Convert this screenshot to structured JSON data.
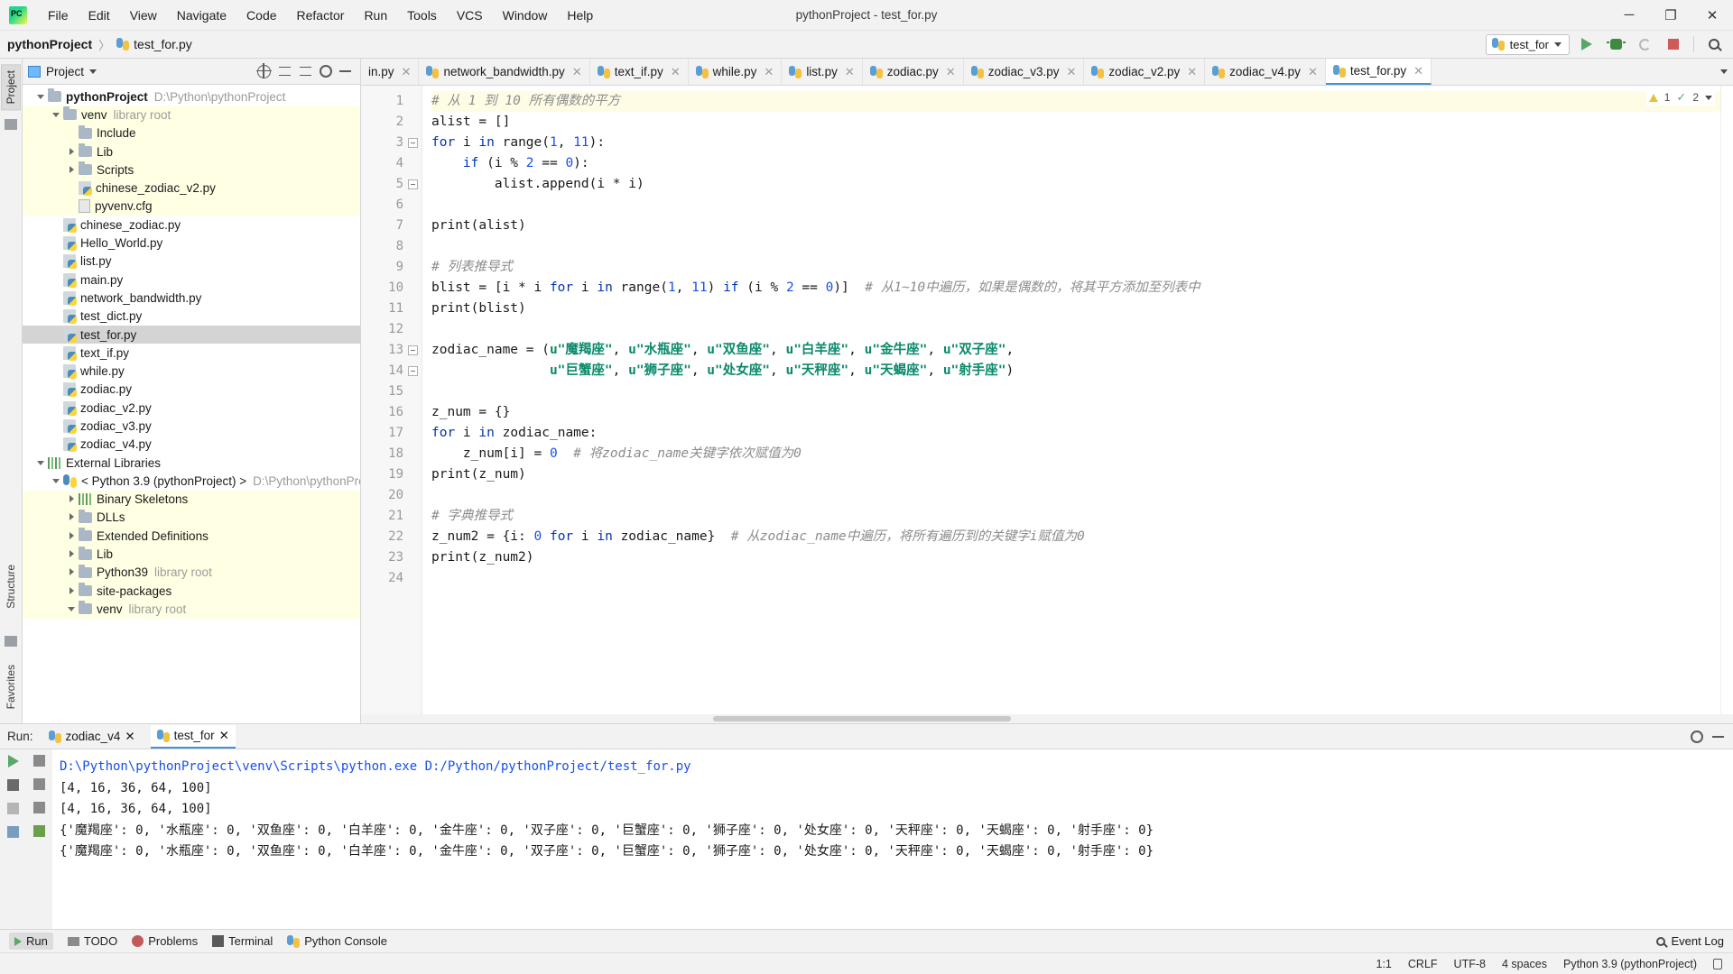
{
  "window": {
    "title": "pythonProject - test_for.py",
    "logo": "pycharm-logo",
    "minimize": "─",
    "maximize": "❐",
    "close": "✕"
  },
  "menu": [
    "File",
    "Edit",
    "View",
    "Navigate",
    "Code",
    "Refactor",
    "Run",
    "Tools",
    "VCS",
    "Window",
    "Help"
  ],
  "breadcrumb": {
    "project": "pythonProject",
    "separator": "〉",
    "file": "test_for.py"
  },
  "toolbar": {
    "run_config": "test_for",
    "run_button": "run-button",
    "debug_button": "debug-button",
    "rerun_button": "rerun-coverage-button",
    "stop_button": "stop-button",
    "search_button": "search-everywhere-button"
  },
  "project_panel": {
    "title": "Project",
    "vertical_tab": "Project",
    "tree": [
      {
        "indent": 0,
        "arrow": "down",
        "icon": "folder",
        "label": "pythonProject",
        "bold": true,
        "detail": "D:\\Python\\pythonProject",
        "highlight": "none"
      },
      {
        "indent": 1,
        "arrow": "down",
        "icon": "folder",
        "label": "venv",
        "bold": false,
        "detail": "library root",
        "highlight": "lib"
      },
      {
        "indent": 2,
        "arrow": "none",
        "icon": "folder",
        "label": "Include",
        "bold": false,
        "detail": "",
        "highlight": "lib"
      },
      {
        "indent": 2,
        "arrow": "right",
        "icon": "folder",
        "label": "Lib",
        "bold": false,
        "detail": "",
        "highlight": "lib"
      },
      {
        "indent": 2,
        "arrow": "right",
        "icon": "folder",
        "label": "Scripts",
        "bold": false,
        "detail": "",
        "highlight": "lib"
      },
      {
        "indent": 2,
        "arrow": "none",
        "icon": "python",
        "label": "chinese_zodiac_v2.py",
        "bold": false,
        "detail": "",
        "highlight": "lib"
      },
      {
        "indent": 2,
        "arrow": "none",
        "icon": "cfg",
        "label": "pyvenv.cfg",
        "bold": false,
        "detail": "",
        "highlight": "lib"
      },
      {
        "indent": 1,
        "arrow": "none",
        "icon": "python",
        "label": "chinese_zodiac.py",
        "bold": false,
        "detail": "",
        "highlight": "none"
      },
      {
        "indent": 1,
        "arrow": "none",
        "icon": "python",
        "label": "Hello_World.py",
        "bold": false,
        "detail": "",
        "highlight": "none"
      },
      {
        "indent": 1,
        "arrow": "none",
        "icon": "python",
        "label": "list.py",
        "bold": false,
        "detail": "",
        "highlight": "none"
      },
      {
        "indent": 1,
        "arrow": "none",
        "icon": "python",
        "label": "main.py",
        "bold": false,
        "detail": "",
        "highlight": "none"
      },
      {
        "indent": 1,
        "arrow": "none",
        "icon": "python",
        "label": "network_bandwidth.py",
        "bold": false,
        "detail": "",
        "highlight": "none"
      },
      {
        "indent": 1,
        "arrow": "none",
        "icon": "python",
        "label": "test_dict.py",
        "bold": false,
        "detail": "",
        "highlight": "none"
      },
      {
        "indent": 1,
        "arrow": "none",
        "icon": "python",
        "label": "test_for.py",
        "bold": false,
        "detail": "",
        "highlight": "selected"
      },
      {
        "indent": 1,
        "arrow": "none",
        "icon": "python",
        "label": "text_if.py",
        "bold": false,
        "detail": "",
        "highlight": "none"
      },
      {
        "indent": 1,
        "arrow": "none",
        "icon": "python",
        "label": "while.py",
        "bold": false,
        "detail": "",
        "highlight": "none"
      },
      {
        "indent": 1,
        "arrow": "none",
        "icon": "python",
        "label": "zodiac.py",
        "bold": false,
        "detail": "",
        "highlight": "none"
      },
      {
        "indent": 1,
        "arrow": "none",
        "icon": "python",
        "label": "zodiac_v2.py",
        "bold": false,
        "detail": "",
        "highlight": "none"
      },
      {
        "indent": 1,
        "arrow": "none",
        "icon": "python",
        "label": "zodiac_v3.py",
        "bold": false,
        "detail": "",
        "highlight": "none"
      },
      {
        "indent": 1,
        "arrow": "none",
        "icon": "python",
        "label": "zodiac_v4.py",
        "bold": false,
        "detail": "",
        "highlight": "none"
      },
      {
        "indent": 0,
        "arrow": "down",
        "icon": "library",
        "label": "External Libraries",
        "bold": false,
        "detail": "",
        "highlight": "none"
      },
      {
        "indent": 1,
        "arrow": "down",
        "icon": "pysnake",
        "label": "< Python 3.9 (pythonProject) >",
        "bold": false,
        "detail": "D:\\Python\\pythonPro",
        "highlight": "none"
      },
      {
        "indent": 2,
        "arrow": "right",
        "icon": "library",
        "label": "Binary Skeletons",
        "bold": false,
        "detail": "",
        "highlight": "lib"
      },
      {
        "indent": 2,
        "arrow": "right",
        "icon": "folder",
        "label": "DLLs",
        "bold": false,
        "detail": "",
        "highlight": "lib"
      },
      {
        "indent": 2,
        "arrow": "right",
        "icon": "folder",
        "label": "Extended Definitions",
        "bold": false,
        "detail": "",
        "highlight": "lib"
      },
      {
        "indent": 2,
        "arrow": "right",
        "icon": "folder",
        "label": "Lib",
        "bold": false,
        "detail": "",
        "highlight": "lib"
      },
      {
        "indent": 2,
        "arrow": "right",
        "icon": "folder",
        "label": "Python39",
        "bold": false,
        "detail": "library root",
        "highlight": "lib"
      },
      {
        "indent": 2,
        "arrow": "right",
        "icon": "folder",
        "label": "site-packages",
        "bold": false,
        "detail": "",
        "highlight": "lib"
      },
      {
        "indent": 2,
        "arrow": "down",
        "icon": "folder",
        "label": "venv",
        "bold": false,
        "detail": "library root",
        "highlight": "lib"
      }
    ]
  },
  "editor": {
    "tabs": [
      {
        "label": "in.py",
        "active": false
      },
      {
        "label": "network_bandwidth.py",
        "active": false
      },
      {
        "label": "text_if.py",
        "active": false
      },
      {
        "label": "while.py",
        "active": false
      },
      {
        "label": "list.py",
        "active": false
      },
      {
        "label": "zodiac.py",
        "active": false
      },
      {
        "label": "zodiac_v3.py",
        "active": false
      },
      {
        "label": "zodiac_v2.py",
        "active": false
      },
      {
        "label": "zodiac_v4.py",
        "active": false
      },
      {
        "label": "test_for.py",
        "active": true
      }
    ],
    "inspection": {
      "warnings": "1",
      "checks": "2"
    },
    "line_numbers": [
      "1",
      "2",
      "3",
      "4",
      "5",
      "6",
      "7",
      "8",
      "9",
      "10",
      "11",
      "12",
      "13",
      "14",
      "15",
      "16",
      "17",
      "18",
      "19",
      "20",
      "21",
      "22",
      "23",
      "24"
    ],
    "lines": [
      "# 从 1 到 10 所有偶数的平方",
      "alist = []",
      "for i in range(1, 11):",
      "    if (i % 2 == 0):",
      "        alist.append(i * i)",
      "",
      "print(alist)",
      "",
      "# 列表推导式",
      "blist = [i * i for i in range(1, 11) if (i % 2 == 0)]  # 从1~10中遍历，如果是偶数的，将其平方添加至列表中",
      "print(blist)",
      "",
      "zodiac_name = (u\"魔羯座\", u\"水瓶座\", u\"双鱼座\", u\"白羊座\", u\"金牛座\", u\"双子座\",",
      "               u\"巨蟹座\", u\"狮子座\", u\"处女座\", u\"天秤座\", u\"天蝎座\", u\"射手座\")",
      "",
      "z_num = {}",
      "for i in zodiac_name:",
      "    z_num[i] = 0  # 将zodiac_name关键字依次赋值为0",
      "print(z_num)",
      "",
      "# 字典推导式",
      "z_num2 = {i: 0 for i in zodiac_name}  # 从zodiac_name中遍历，将所有遍历到的关键字i赋值为0",
      "print(z_num2)",
      ""
    ]
  },
  "run_panel": {
    "label": "Run:",
    "tabs": [
      {
        "label": "zodiac_v4",
        "active": false
      },
      {
        "label": "test_for",
        "active": true
      }
    ],
    "console": [
      "D:\\Python\\pythonProject\\venv\\Scripts\\python.exe D:/Python/pythonProject/test_for.py",
      "[4, 16, 36, 64, 100]",
      "[4, 16, 36, 64, 100]",
      "{'魔羯座': 0, '水瓶座': 0, '双鱼座': 0, '白羊座': 0, '金牛座': 0, '双子座': 0, '巨蟹座': 0, '狮子座': 0, '处女座': 0, '天秤座': 0, '天蝎座': 0, '射手座': 0}",
      "{'魔羯座': 0, '水瓶座': 0, '双鱼座': 0, '白羊座': 0, '金牛座': 0, '双子座': 0, '巨蟹座': 0, '狮子座': 0, '处女座': 0, '天秤座': 0, '天蝎座': 0, '射手座': 0}"
    ]
  },
  "left_strip": {
    "structure": "Structure",
    "favorites": "Favorites"
  },
  "bottom_tools": [
    {
      "label": "Run",
      "icon": "run-icon",
      "active": true
    },
    {
      "label": "TODO",
      "icon": "todo-icon",
      "active": false
    },
    {
      "label": "Problems",
      "icon": "problems-icon",
      "active": false
    },
    {
      "label": "Terminal",
      "icon": "terminal-icon",
      "active": false
    },
    {
      "label": "Python Console",
      "icon": "python-console-icon",
      "active": false
    }
  ],
  "event_log": "Event Log",
  "statusbar": {
    "caret": "1:1",
    "line_separator": "CRLF",
    "encoding": "UTF-8",
    "indent": "4 spaces",
    "interpreter": "Python 3.9 (pythonProject)",
    "lock": "lock-icon"
  }
}
